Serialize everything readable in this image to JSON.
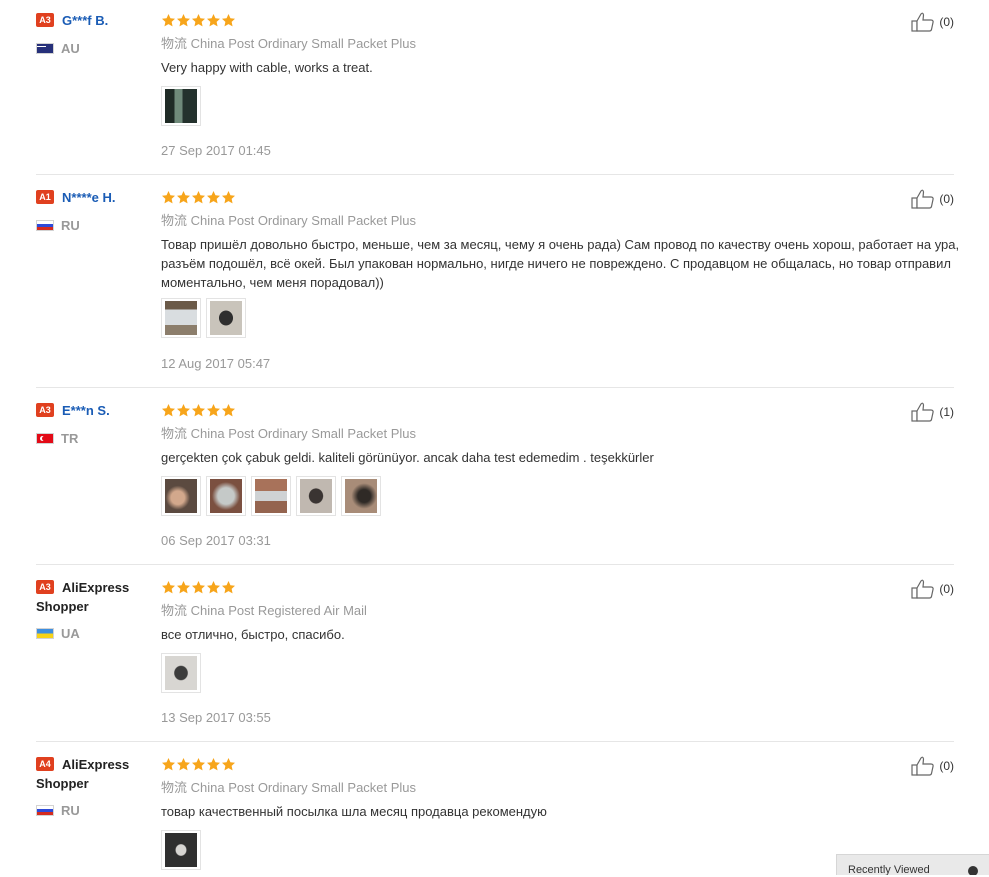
{
  "reviews": [
    {
      "badge": "A3",
      "name": "G***f B.",
      "country_code": "AU",
      "flag": "au",
      "rating": 5,
      "shipping": "物流 China Post Ordinary Small Packet Plus",
      "text": "Very happy with cable, works a treat.",
      "photo_count": 1,
      "date": "27 Sep 2017 01:45",
      "useful_count": "(0)"
    },
    {
      "badge": "A1",
      "name": "N****e H.",
      "country_code": "RU",
      "flag": "ru",
      "rating": 5,
      "shipping": "物流 China Post Ordinary Small Packet Plus",
      "text": "Товар пришёл довольно быстро, меньше, чем за месяц, чему я очень рада) Сам провод по качеству очень хорош, работает на ура, разъём подошёл, всё окей. Был упакован нормально, нигде ничего не повреждено. С продавцом не общалась, но товар отправил моментально, чем меня порадовал))",
      "photo_count": 2,
      "date": "12 Aug 2017 05:47",
      "useful_count": "(0)"
    },
    {
      "badge": "A3",
      "name": "E***n S.",
      "country_code": "TR",
      "flag": "tr",
      "rating": 5,
      "shipping": "物流 China Post Ordinary Small Packet Plus",
      "text": "gerçekten çok çabuk geldi. kaliteli görünüyor. ancak daha test edemedim . teşekkürler",
      "photo_count": 5,
      "date": "06 Sep 2017 03:31",
      "useful_count": "(1)"
    },
    {
      "badge": "A3",
      "name": "AliExpress Shopper",
      "country_code": "UA",
      "flag": "ua",
      "rating": 5,
      "shipping": "物流 China Post Registered Air Mail",
      "text": "все отлично, быстро, спасибо.",
      "photo_count": 1,
      "date": "13 Sep 2017 03:55",
      "useful_count": "(0)"
    },
    {
      "badge": "A4",
      "name": "AliExpress Shopper",
      "country_code": "RU",
      "flag": "ru",
      "rating": 5,
      "shipping": "物流 China Post Ordinary Small Packet Plus",
      "text": "товар качественный посылка шла месяц продавца рекомендую",
      "photo_count": 1,
      "date": "",
      "useful_count": "(0)"
    }
  ],
  "colors": {
    "badge": "#e0401f",
    "star": "#f7a51b",
    "name_link": "#1a5cb5",
    "muted": "#999999"
  },
  "icons": {
    "rating": "star-icon",
    "useful": "thumbs-up-icon"
  },
  "recent_panel": {
    "label": "Recently Viewed"
  }
}
